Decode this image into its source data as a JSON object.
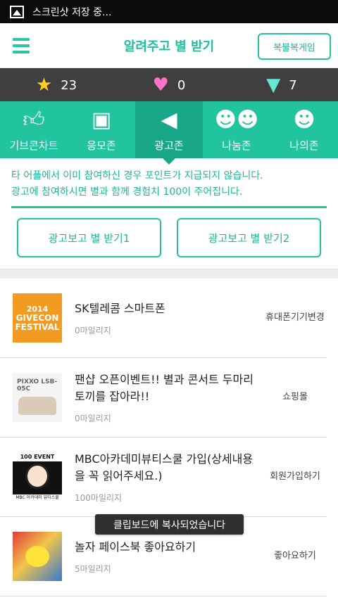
{
  "status_bar": {
    "icon": "image-icon",
    "text": "스크린샷 저장 중..."
  },
  "app_bar": {
    "menu_icon": "hamburger-menu-icon",
    "title": "알려주고 별 받기",
    "lucky_button": "복불복게임"
  },
  "stats": [
    {
      "icon": "star-icon",
      "value": "23"
    },
    {
      "icon": "heart-icon",
      "value": "0"
    },
    {
      "icon": "ice-cream-icon",
      "value": "7"
    }
  ],
  "tabs": [
    {
      "icon": "thumbs-up-icon",
      "label": "기브콘차트",
      "active": false
    },
    {
      "icon": "gift-box-icon",
      "label": "응모존",
      "active": false
    },
    {
      "icon": "megaphone-icon",
      "label": "광고존",
      "active": true
    },
    {
      "icon": "people-icon",
      "label": "나눔존",
      "active": false
    },
    {
      "icon": "person-icon",
      "label": "나의존",
      "active": false
    }
  ],
  "notice": {
    "line1": "타 어플에서 이미 참여하신 경우 포인트가 지급되지 않습니다.",
    "line2": "광고에 참여하시면 별과 함께 경험치 100이 주어집니다."
  },
  "ad_buttons": {
    "first": "광고보고 별 받기1",
    "second": "광고보고 별 받기2"
  },
  "list": [
    {
      "thumb_year": "2014",
      "thumb_text": "GIVECON FESTIVAL",
      "title": "SK텔레콤 스마트폰",
      "points": "0마일리지",
      "category": "휴대폰기기변경"
    },
    {
      "thumb_text": "PIXXO LSB-05C",
      "title": "팬샵 오픈이벤트!! 별과 콘서트 두마리 토끼를 잡아라!!",
      "points": "0마일리지",
      "category": "쇼핑몰"
    },
    {
      "thumb_text": "100 EVENT",
      "thumb_bottom": "MBC 아카데미 뷰티스쿨",
      "title": "MBC아카데미뷰티스쿨 가입(상세내용을 꼭 읽어주세요.)",
      "points": "100마일리지",
      "category": "회원가입하기"
    },
    {
      "title": "놀자 페이스북 좋아요하기",
      "points": "5마일리지",
      "category": "좋아요하기"
    }
  ],
  "toast": "클립보드에 복사되었습니다",
  "colors": {
    "accent": "#22c39f",
    "accent_dark": "#18a788",
    "stats_bg": "#3f3f3f"
  }
}
